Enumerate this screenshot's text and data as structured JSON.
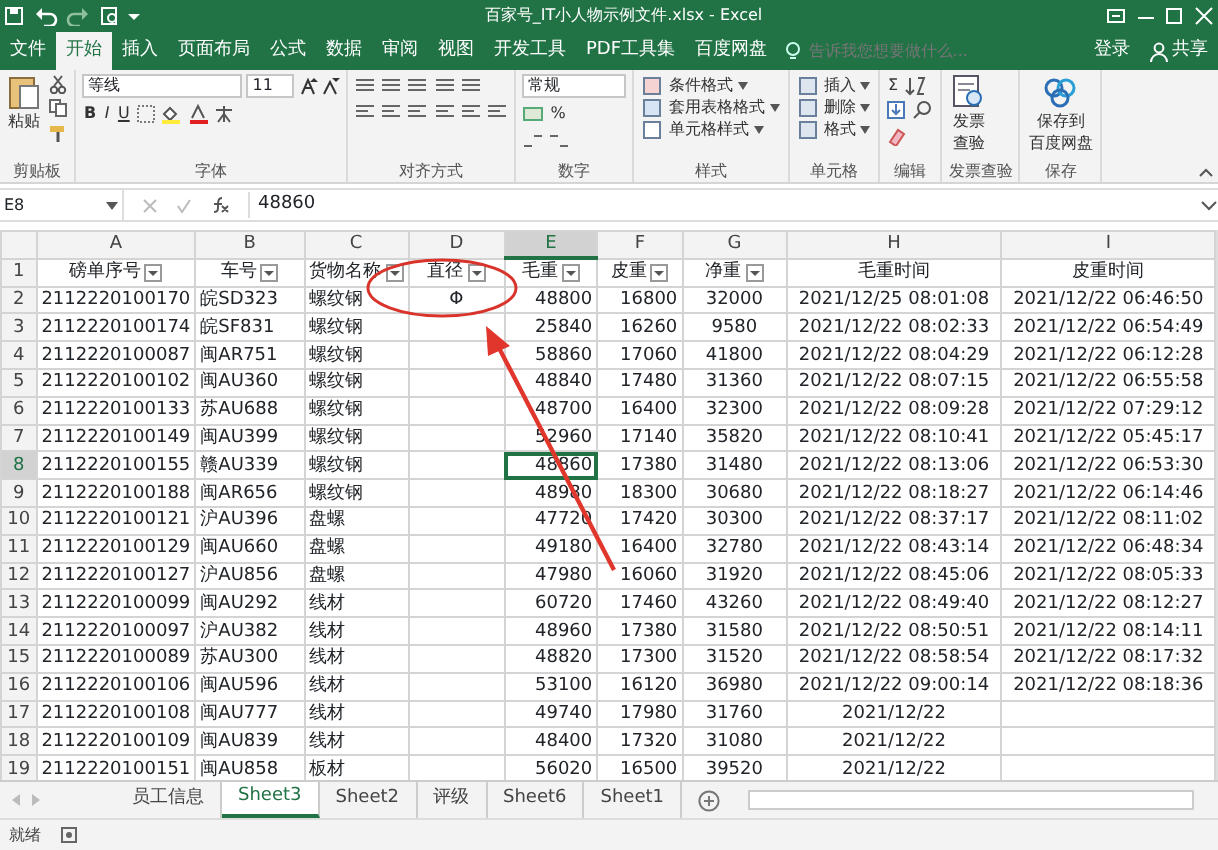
{
  "window": {
    "title": "百家号_IT小人物示例文件.xlsx - Excel"
  },
  "menu_tabs": [
    {
      "label": "文件",
      "selected": false
    },
    {
      "label": "开始",
      "selected": true
    },
    {
      "label": "插入",
      "selected": false
    },
    {
      "label": "页面布局",
      "selected": false
    },
    {
      "label": "公式",
      "selected": false
    },
    {
      "label": "数据",
      "selected": false
    },
    {
      "label": "审阅",
      "selected": false
    },
    {
      "label": "视图",
      "selected": false
    },
    {
      "label": "开发工具",
      "selected": false
    },
    {
      "label": "PDF工具集",
      "selected": false
    },
    {
      "label": "百度网盘",
      "selected": false
    }
  ],
  "tell_me": {
    "placeholder": "告诉我您想要做什么..."
  },
  "account": {
    "sign_in": "登录",
    "share": "共享"
  },
  "ribbon": [
    {
      "kind": "clipboard",
      "label": "剪贴板",
      "texts": [
        "粘贴"
      ]
    },
    {
      "kind": "font",
      "label": "字体",
      "texts": [
        "等线",
        "11",
        "B",
        "I",
        "U"
      ]
    },
    {
      "kind": "alignment",
      "label": "对齐方式"
    },
    {
      "kind": "number",
      "label": "数字",
      "texts": [
        "常规",
        "%"
      ]
    },
    {
      "kind": "styles",
      "label": "样式",
      "texts": [
        "条件格式",
        "套用表格格式",
        "单元格样式"
      ]
    },
    {
      "kind": "cells",
      "label": "单元格",
      "texts": [
        "插入",
        "删除",
        "格式"
      ]
    },
    {
      "kind": "editing",
      "label": "编辑",
      "texts": [
        "Σ"
      ]
    },
    {
      "kind": "invoice",
      "label": "发票查验",
      "texts": [
        "发票",
        "查验"
      ]
    },
    {
      "kind": "save",
      "label": "保存",
      "texts": [
        "保存到",
        "百度网盘"
      ]
    }
  ],
  "header_row_number": "1",
  "formula_bar": {
    "name_box": "E8",
    "value": "48860"
  },
  "columns": [
    {
      "letter": "A",
      "heading": "磅单序号",
      "filter": true,
      "selected": false
    },
    {
      "letter": "B",
      "heading": "车号",
      "filter": true,
      "selected": false
    },
    {
      "letter": "C",
      "heading": "货物名称",
      "filter": true,
      "selected": false
    },
    {
      "letter": "D",
      "heading": "直径",
      "filter": true,
      "selected": false
    },
    {
      "letter": "E",
      "heading": "毛重",
      "filter": true,
      "selected": true
    },
    {
      "letter": "F",
      "heading": "皮重",
      "filter": true,
      "selected": false
    },
    {
      "letter": "G",
      "heading": "净重",
      "filter": true,
      "selected": false
    },
    {
      "letter": "H",
      "heading": "毛重时间",
      "filter": false,
      "selected": false
    },
    {
      "letter": "I",
      "heading": "皮重时间",
      "filter": false,
      "selected": false
    }
  ],
  "rows": [
    {
      "number": "2",
      "selected": false,
      "cells": [
        "2112220100170",
        "皖SD323",
        "螺纹钢",
        "Φ",
        "48800",
        "16800",
        "32000",
        "2021/12/25 08:01:08",
        "2021/12/22 06:46:50"
      ]
    },
    {
      "number": "3",
      "selected": false,
      "cells": [
        "2112220100174",
        "皖SF831",
        "螺纹钢",
        "",
        "25840",
        "16260",
        "9580",
        "2021/12/22 08:02:33",
        "2021/12/22 06:54:49"
      ]
    },
    {
      "number": "4",
      "selected": false,
      "cells": [
        "2112220100087",
        "闽AR751",
        "螺纹钢",
        "",
        "58860",
        "17060",
        "41800",
        "2021/12/22 08:04:29",
        "2021/12/22 06:12:28"
      ]
    },
    {
      "number": "5",
      "selected": false,
      "cells": [
        "2112220100102",
        "闽AU360",
        "螺纹钢",
        "",
        "48840",
        "17480",
        "31360",
        "2021/12/22 08:07:15",
        "2021/12/22 06:55:58"
      ]
    },
    {
      "number": "6",
      "selected": false,
      "cells": [
        "2112220100133",
        "苏AU688",
        "螺纹钢",
        "",
        "48700",
        "16400",
        "32300",
        "2021/12/22 08:09:28",
        "2021/12/22 07:29:12"
      ]
    },
    {
      "number": "7",
      "selected": false,
      "cells": [
        "2112220100149",
        "闽AU399",
        "螺纹钢",
        "",
        "52960",
        "17140",
        "35820",
        "2021/12/22 08:10:41",
        "2021/12/22 05:45:17"
      ]
    },
    {
      "number": "8",
      "selected": true,
      "cells": [
        "2112220100155",
        "赣AU339",
        "螺纹钢",
        "",
        "48860",
        "17380",
        "31480",
        "2021/12/22 08:13:06",
        "2021/12/22 06:53:30"
      ]
    },
    {
      "number": "9",
      "selected": false,
      "cells": [
        "2112220100188",
        "闽AR656",
        "螺纹钢",
        "",
        "48980",
        "18300",
        "30680",
        "2021/12/22 08:18:27",
        "2021/12/22 06:14:46"
      ]
    },
    {
      "number": "10",
      "selected": false,
      "cells": [
        "2112220100121",
        "沪AU396",
        "盘螺",
        "",
        "47720",
        "17420",
        "30300",
        "2021/12/22 08:37:17",
        "2021/12/22 08:11:02"
      ]
    },
    {
      "number": "11",
      "selected": false,
      "cells": [
        "2112220100129",
        "闽AU660",
        "盘螺",
        "",
        "49180",
        "16400",
        "32780",
        "2021/12/22 08:43:14",
        "2021/12/22 06:48:34"
      ]
    },
    {
      "number": "12",
      "selected": false,
      "cells": [
        "2112220100127",
        "沪AU856",
        "盘螺",
        "",
        "47980",
        "16060",
        "31920",
        "2021/12/22 08:45:06",
        "2021/12/22 08:05:33"
      ]
    },
    {
      "number": "13",
      "selected": false,
      "cells": [
        "2112220100099",
        "闽AU292",
        "线材",
        "",
        "60720",
        "17460",
        "43260",
        "2021/12/22 08:49:40",
        "2021/12/22 08:12:27"
      ]
    },
    {
      "number": "14",
      "selected": false,
      "cells": [
        "2112220100097",
        "沪AU382",
        "线材",
        "",
        "48960",
        "17380",
        "31580",
        "2021/12/22 08:50:51",
        "2021/12/22 08:14:11"
      ]
    },
    {
      "number": "15",
      "selected": false,
      "cells": [
        "2112220100089",
        "苏AU300",
        "线材",
        "",
        "48820",
        "17300",
        "31520",
        "2021/12/22 08:58:54",
        "2021/12/22 08:17:32"
      ]
    },
    {
      "number": "16",
      "selected": false,
      "cells": [
        "2112220100106",
        "闽AU596",
        "线材",
        "",
        "53100",
        "16120",
        "36980",
        "2021/12/22 09:00:14",
        "2021/12/22 08:18:36"
      ]
    },
    {
      "number": "17",
      "selected": false,
      "cells": [
        "2112220100108",
        "闽AU777",
        "线材",
        "",
        "49740",
        "17980",
        "31760",
        "2021/12/22",
        ""
      ]
    },
    {
      "number": "18",
      "selected": false,
      "cells": [
        "2112220100109",
        "闽AU839",
        "线材",
        "",
        "48400",
        "17320",
        "31080",
        "2021/12/22",
        ""
      ]
    },
    {
      "number": "19",
      "selected": false,
      "cells": [
        "2112220100151",
        "闽AU858",
        "板材",
        "",
        "56020",
        "16500",
        "39520",
        "2021/12/22",
        ""
      ]
    }
  ],
  "sheet_tabs": [
    {
      "label": "员工信息",
      "selected": false
    },
    {
      "label": "Sheet3",
      "selected": true
    },
    {
      "label": "Sheet2",
      "selected": false
    },
    {
      "label": "评级",
      "selected": false
    },
    {
      "label": "Sheet6",
      "selected": false
    },
    {
      "label": "Sheet1",
      "selected": false
    }
  ],
  "status_bar": {
    "text": "就绪"
  }
}
